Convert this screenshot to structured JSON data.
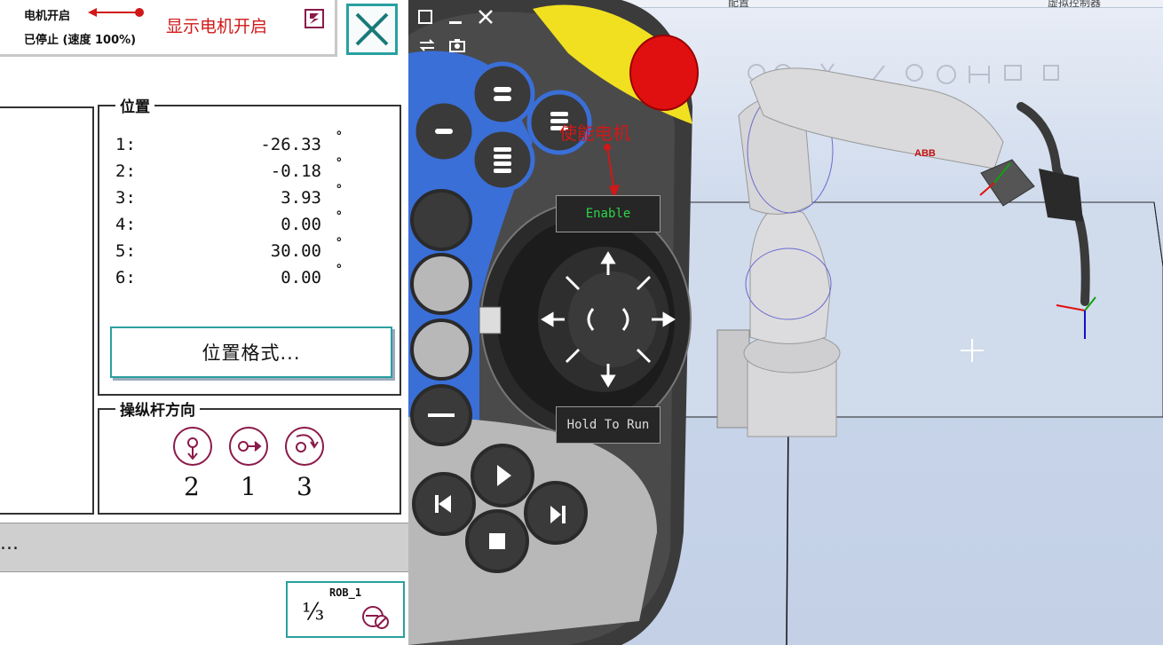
{
  "status": {
    "motor_state": "电机开启",
    "run_state": "已停止 (速度 100%)",
    "annotation": "显示电机开启"
  },
  "position": {
    "title": "位置",
    "rows": [
      {
        "axis": "1:",
        "value": "-26.33",
        "unit": "°"
      },
      {
        "axis": "2:",
        "value": "-0.18",
        "unit": "°"
      },
      {
        "axis": "3:",
        "value": "3.93",
        "unit": "°"
      },
      {
        "axis": "4:",
        "value": "0.00",
        "unit": "°"
      },
      {
        "axis": "5:",
        "value": "30.00",
        "unit": "°"
      },
      {
        "axis": "6:",
        "value": "0.00",
        "unit": "°"
      }
    ],
    "format_button": "位置格式..."
  },
  "joystick": {
    "title": "操纵杆方向",
    "directions": [
      "2",
      "1",
      "3"
    ]
  },
  "status_bar": {
    "text": "..."
  },
  "robot_selector": {
    "label": "ROB_1",
    "fraction": "⅓"
  },
  "pendant": {
    "enable_label": "Enable",
    "hold_to_run_label": "Hold To Run",
    "enable_annotation": "使能电机"
  },
  "viewport": {
    "tab_left": "配置",
    "tab_right": "虚拟控制器",
    "robot_brand": "ABB"
  },
  "colors": {
    "accent_teal": "#2aa0a0",
    "annotation_red": "#d01818",
    "pendant_blue": "#3a6fd8",
    "emergency_red": "#e01010",
    "emergency_yellow": "#f0e020"
  }
}
